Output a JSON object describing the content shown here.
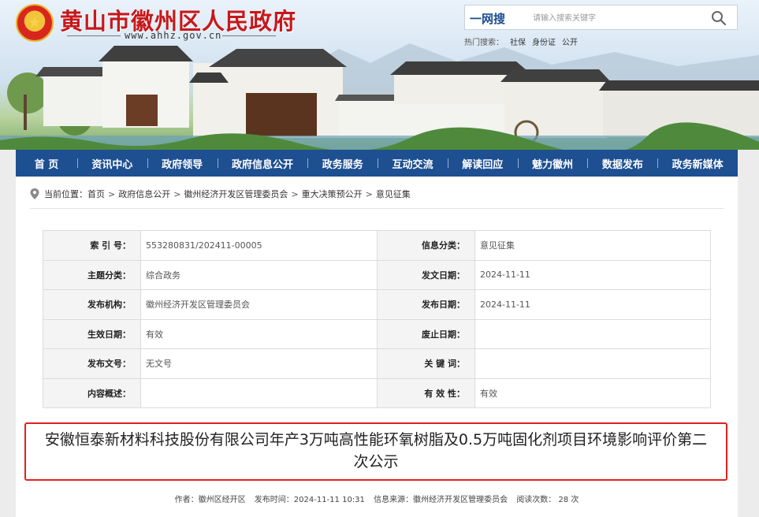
{
  "header": {
    "title": "黄山市徽州区人民政府",
    "url": "www.ahhz.gov.cn",
    "search": {
      "label": "一网搜",
      "placeholder": "请输入搜索关键字",
      "hot_label": "热门搜索：",
      "hot_items": [
        "社保",
        "身份证",
        "公开"
      ]
    }
  },
  "nav": [
    "首 页",
    "资讯中心",
    "政府领导",
    "政府信息公开",
    "政务服务",
    "互动交流",
    "解读回应",
    "魅力徽州",
    "数据发布",
    "政务新媒体"
  ],
  "breadcrumb": {
    "prefix": "当前位置：",
    "items": [
      "首页",
      "政府信息公开",
      "徽州经济开发区管理委员会",
      "重大决策预公开",
      "意见征集"
    ]
  },
  "meta": {
    "rows": [
      [
        "索 引 号：",
        "553280831/202411-00005",
        "信息分类：",
        "意见征集"
      ],
      [
        "主题分类：",
        "综合政务",
        "发文日期：",
        "2024-11-11"
      ],
      [
        "发布机构：",
        "徽州经济开发区管理委员会",
        "发布日期：",
        "2024-11-11"
      ],
      [
        "生效日期：",
        "有效",
        "废止日期：",
        ""
      ],
      [
        "发布文号：",
        "无文号",
        "关 键 词：",
        ""
      ],
      [
        "内容概述：",
        "",
        "有 效 性：",
        "有效"
      ]
    ]
  },
  "article": {
    "title": "安徽恒泰新材料科技股份有限公司年产3万吨高性能环氧树脂及0.5万吨固化剂项目环境影响评价第二次公示",
    "author": "作者：徽州区经开区",
    "time": "发布时间：2024-11-11 10:31",
    "source": "信息来源：徽州经济开发区管理委员会",
    "views": "阅读次数： 28 次"
  },
  "colors": {
    "brand_red": "#c7181b",
    "nav_blue": "#1d4f91",
    "highlight_border": "#e0211f"
  },
  "icons": {
    "emblem": "national-emblem-icon",
    "search": "search-icon",
    "location": "location-pin-icon"
  }
}
